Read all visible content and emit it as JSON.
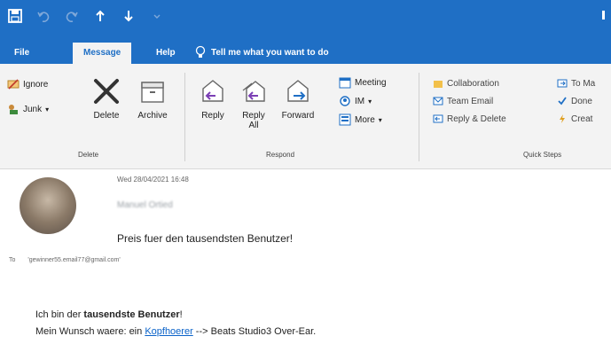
{
  "tabs": [
    "File",
    "Message",
    "Help",
    "Tell me what you want to do"
  ],
  "groups": {
    "delete": {
      "label": "Delete",
      "ignore": "Ignore",
      "junk": "Junk",
      "junk_arrow": "▾",
      "delete": "Delete",
      "archive": "Archive"
    },
    "respond": {
      "label": "Respond",
      "reply": "Reply",
      "reply_all_line1": "Reply",
      "reply_all_line2": "All",
      "forward": "Forward",
      "meeting": "Meeting",
      "im": "IM",
      "more": "More",
      "arrow": "▾"
    },
    "quick_steps": {
      "label": "Quick Steps",
      "items": [
        "Collaboration",
        "Team Email",
        "Reply & Delete",
        "To Ma",
        "Done",
        "Creat"
      ]
    }
  },
  "message": {
    "date": "Wed 28/04/2021 16:48",
    "sender": "Manuel Ortied",
    "subject": "Preis fuer den tausendsten Benutzer!",
    "to_label": "To",
    "to_address": "'gewinner55.email77@gmail.com'",
    "body": {
      "line1_a": "Ich bin der ",
      "line1_b": "tausendste Benutzer",
      "line1_c": "!",
      "line2_a": "Mein Wunsch waere: ein ",
      "line2_link": "Kopfhoerer",
      "line2_c": " --> Beats Studio3 Over-Ear."
    }
  }
}
